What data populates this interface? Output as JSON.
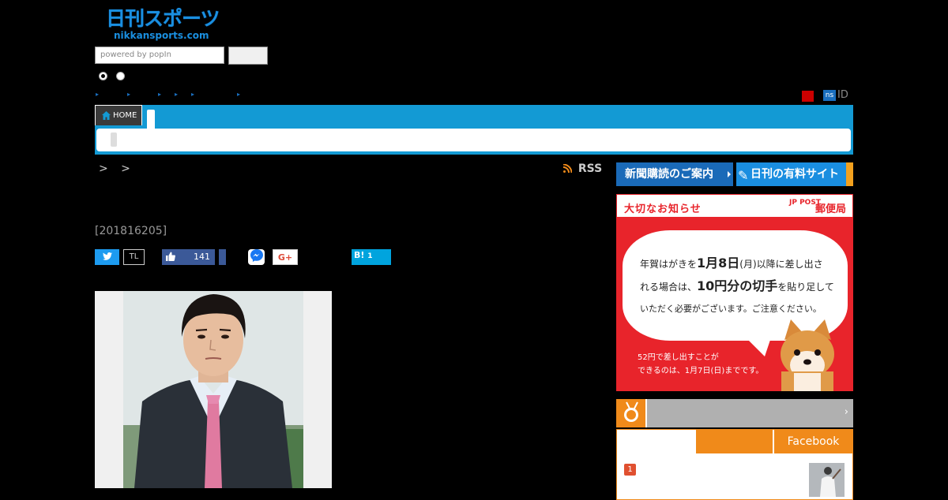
{
  "logo": {
    "line1": "日刊スポーツ",
    "line2": "nikkansports.com"
  },
  "search": {
    "placeholder": "powered by popIn"
  },
  "account": {
    "ns_badge": "ns",
    "id_label": "ID"
  },
  "nav": {
    "home_label": "HOME"
  },
  "breadcrumb": {
    "separators": "> >"
  },
  "rss": {
    "label": "RSS"
  },
  "article": {
    "date": "[201816205]"
  },
  "social": {
    "twitter_icon": "twitter-bird",
    "tl_label": "TL",
    "fb_count": "141",
    "gplus_label": "G+",
    "hatena_label": "B!",
    "hatena_count": "1"
  },
  "sidebar": {
    "subscription_label": "新聞購読のご案内",
    "paid_site_label": "日刊の有料サイト",
    "notice": {
      "title": "大切なお知らせ",
      "org": "郵便局",
      "jp_post": "JP POST",
      "line1_a": "年賀はがきを",
      "line1_b": "1月8日",
      "line1_c": "(月)以降に差し出さ",
      "line2_a": "れる場合は、",
      "line2_b": "10円分の切手",
      "line2_c": "を貼り足して",
      "line3": "いただく必要がございます。ご注意ください。",
      "small1": "52円で差し出すことが",
      "small2": "できるのは、1月7日(日)までです。"
    },
    "ranking": {
      "tab_facebook": "Facebook",
      "first_rank": "1"
    }
  },
  "colors": {
    "nav_blue": "#139ad4",
    "accent_orange": "#f08a1a",
    "notice_red": "#e8242b"
  }
}
